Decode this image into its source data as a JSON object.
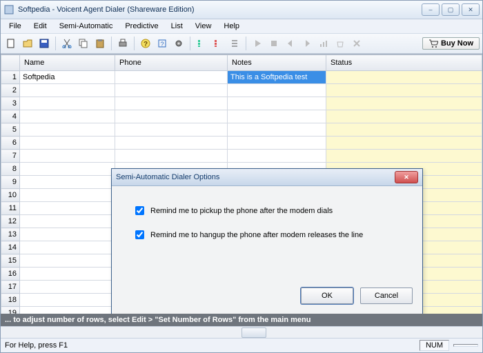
{
  "window": {
    "title": "Softpedia - Voicent Agent Dialer (Shareware Edition)",
    "sysbuttons": {
      "min": "–",
      "max": "▢",
      "close": "✕"
    }
  },
  "menu": [
    "File",
    "Edit",
    "Semi-Automatic",
    "Predictive",
    "List",
    "View",
    "Help"
  ],
  "toolbar": {
    "new": "new-icon",
    "open": "open-icon",
    "save": "save-icon",
    "cut": "cut-icon",
    "copy": "copy-icon",
    "paste": "paste-icon",
    "print": "print-icon",
    "about": "about-icon",
    "help": "help-icon",
    "gear": "gear-icon",
    "play": "play-icon",
    "stop": "stop-icon",
    "prev": "prev-icon",
    "next": "next-icon",
    "chart": "chart-icon",
    "bag": "bag-icon",
    "x": "x-icon",
    "buynow_label": "Buy Now"
  },
  "grid": {
    "headers": [
      "Name",
      "Phone",
      "Notes",
      "Status"
    ],
    "rows": [
      {
        "name": "Softpedia",
        "phone": "",
        "notes": "This is a Softpedia test",
        "status": ""
      }
    ],
    "total_rows": 20
  },
  "hintbar": "... to adjust number of rows, select Edit > \"Set Number of Rows\" from the main menu",
  "statusbar": {
    "help": "For Help, press F1",
    "num": "NUM"
  },
  "dialog": {
    "title": "Semi-Automatic Dialer Options",
    "opt1": "Remind me to pickup the phone after the modem dials",
    "opt2": "Remind me to hangup the phone after modem releases the line",
    "ok": "OK",
    "cancel": "Cancel"
  }
}
